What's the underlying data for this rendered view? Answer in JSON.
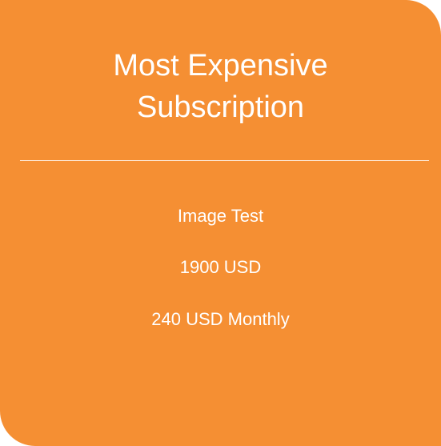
{
  "card": {
    "title_line1": "Most Expensive",
    "title_line2": "Subscription",
    "subscription_name": "Image Test",
    "price": "1900 USD",
    "monthly": "240 USD Monthly",
    "colors": {
      "card_background": "#f58f33",
      "text": "#ffffff"
    }
  }
}
